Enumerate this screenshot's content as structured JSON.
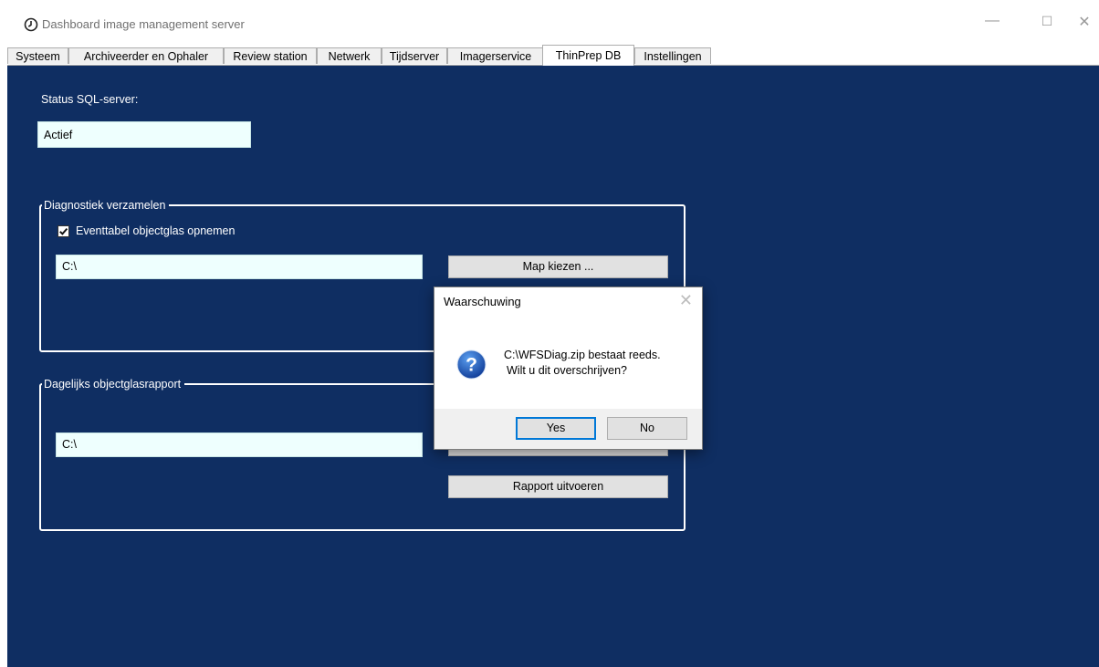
{
  "window": {
    "title": "Dashboard image management server",
    "minimize": "—",
    "maximize": "☐",
    "close": "✕"
  },
  "tabs": [
    {
      "label": "Systeem"
    },
    {
      "label": "Archiveerder en Ophaler"
    },
    {
      "label": "Review station"
    },
    {
      "label": "Netwerk"
    },
    {
      "label": "Tijdserver"
    },
    {
      "label": "Imagerservice"
    },
    {
      "label": "ThinPrep DB",
      "active": true
    },
    {
      "label": "Instellingen"
    }
  ],
  "main": {
    "sql_status_label": "Status SQL-server:",
    "sql_status_value": "Actief",
    "diag_group": {
      "title": "Diagnostiek verzamelen",
      "checkbox_label": "Eventtabel objectglas opnemen",
      "checkbox_checked": true,
      "path_value": "C:\\",
      "choose_folder_button": "Map kiezen ..."
    },
    "report_group": {
      "title": "Dagelijks objectglasrapport",
      "path_value": "C:\\",
      "run_report_button": "Rapport uitvoeren"
    }
  },
  "dialog": {
    "title": "Waarschuwing",
    "close": "✕",
    "icon": "question-icon",
    "message_line1": "C:\\WFSDiag.zip bestaat reeds.",
    "message_line2": "Wilt u dit overschrijven?",
    "yes_button": "Yes",
    "no_button": "No"
  },
  "colors": {
    "panel_background": "#0f2e62",
    "field_background": "#eefffe",
    "dialog_default_border": "#0078d7"
  }
}
